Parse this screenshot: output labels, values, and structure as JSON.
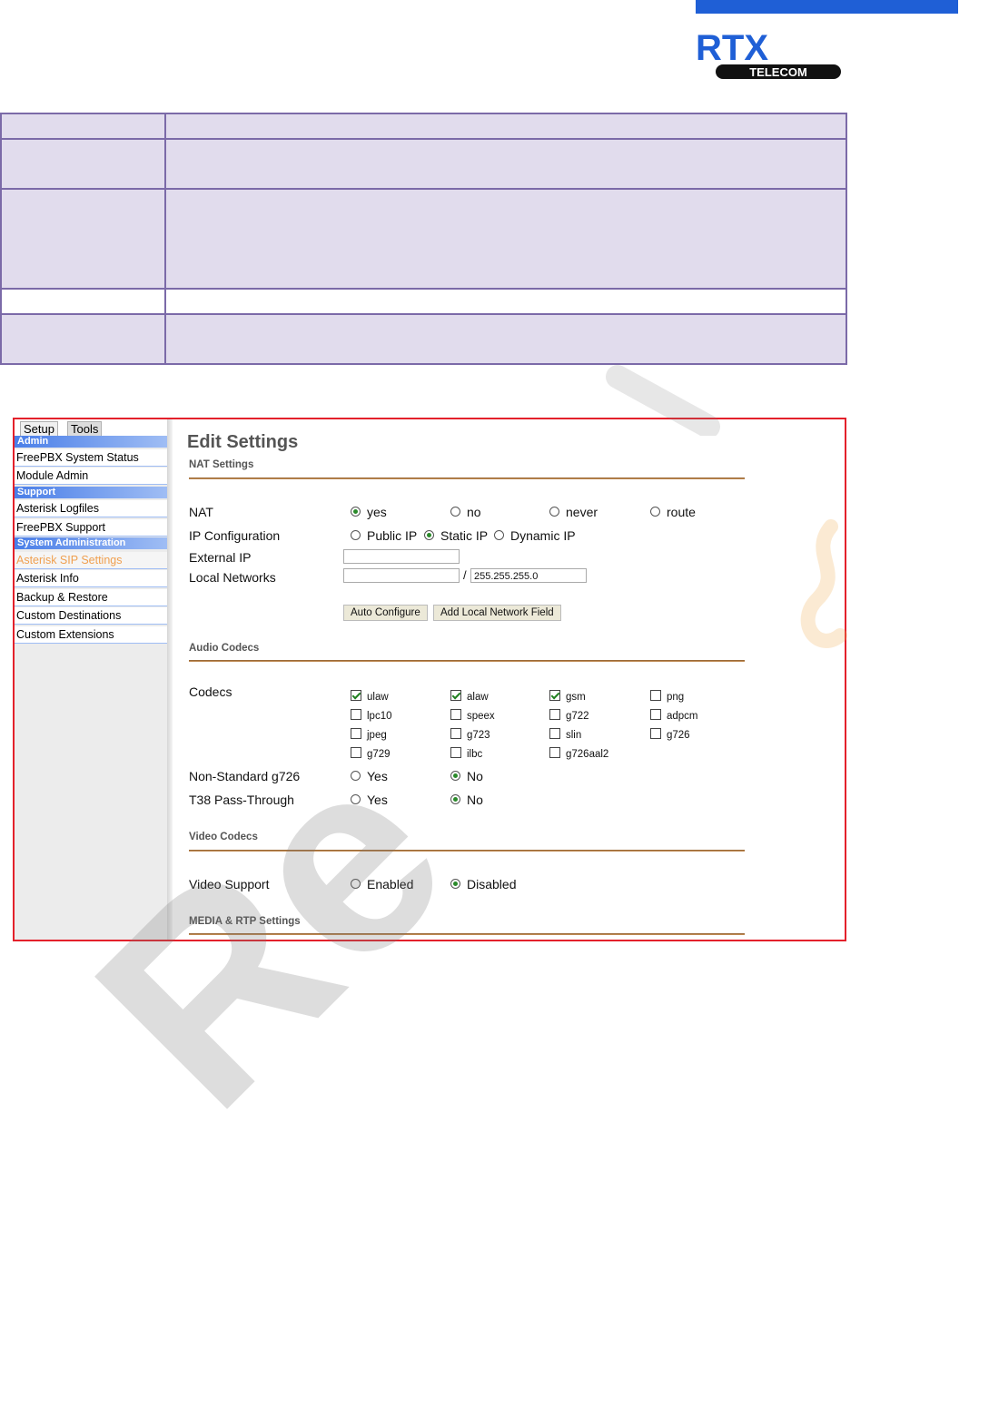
{
  "logo": {
    "brand": "RTX",
    "sub": "TELECOM",
    "colors": {
      "bar": "#1f5fd6",
      "brand": "#1f5fd6",
      "sub_bg": "#111111"
    }
  },
  "watermark": {
    "text": "Re"
  },
  "screenshot": {
    "tabs": [
      "Setup",
      "Tools"
    ],
    "sidebar": {
      "groups": [
        "Admin",
        "Support",
        "System Administration"
      ],
      "items": [
        "FreePBX System Status",
        "Module Admin",
        "Asterisk Logfiles",
        "FreePBX Support",
        "Asterisk SIP Settings",
        "Asterisk Info",
        "Backup & Restore",
        "Custom Destinations",
        "Custom Extensions"
      ],
      "active_item": "Asterisk SIP Settings"
    },
    "page_title": "Edit Settings",
    "sections": {
      "nat": "NAT Settings",
      "audio": "Audio Codecs",
      "video": "Video Codecs",
      "media": "MEDIA & RTP Settings"
    },
    "nat": {
      "label": "NAT",
      "options": [
        "yes",
        "no",
        "never",
        "route"
      ],
      "selected": "yes"
    },
    "ip_config": {
      "label": "IP Configuration",
      "options": [
        "Public IP",
        "Static IP",
        "Dynamic IP"
      ],
      "selected": "Static IP"
    },
    "external_ip": {
      "label": "External IP",
      "value": ""
    },
    "local_networks": {
      "label": "Local Networks",
      "value": "",
      "separator": "/",
      "mask": "255.255.255.0"
    },
    "buttons": {
      "auto_configure": "Auto Configure",
      "add_local_network": "Add Local Network Field"
    },
    "codecs": {
      "label": "Codecs",
      "items": [
        {
          "name": "ulaw",
          "checked": true
        },
        {
          "name": "alaw",
          "checked": true
        },
        {
          "name": "gsm",
          "checked": true
        },
        {
          "name": "png",
          "checked": false
        },
        {
          "name": "lpc10",
          "checked": false
        },
        {
          "name": "speex",
          "checked": false
        },
        {
          "name": "g722",
          "checked": false
        },
        {
          "name": "adpcm",
          "checked": false
        },
        {
          "name": "jpeg",
          "checked": false
        },
        {
          "name": "g723",
          "checked": false
        },
        {
          "name": "slin",
          "checked": false
        },
        {
          "name": "g726",
          "checked": false
        },
        {
          "name": "g729",
          "checked": false
        },
        {
          "name": "ilbc",
          "checked": false
        },
        {
          "name": "g726aal2",
          "checked": false
        }
      ]
    },
    "non_standard_g726": {
      "label": "Non-Standard g726",
      "options": [
        "Yes",
        "No"
      ],
      "selected": "No"
    },
    "t38": {
      "label": "T38 Pass-Through",
      "options": [
        "Yes",
        "No"
      ],
      "selected": "No"
    },
    "video_support": {
      "label": "Video Support",
      "options": [
        "Enabled",
        "Disabled"
      ],
      "selected": "Disabled"
    }
  }
}
